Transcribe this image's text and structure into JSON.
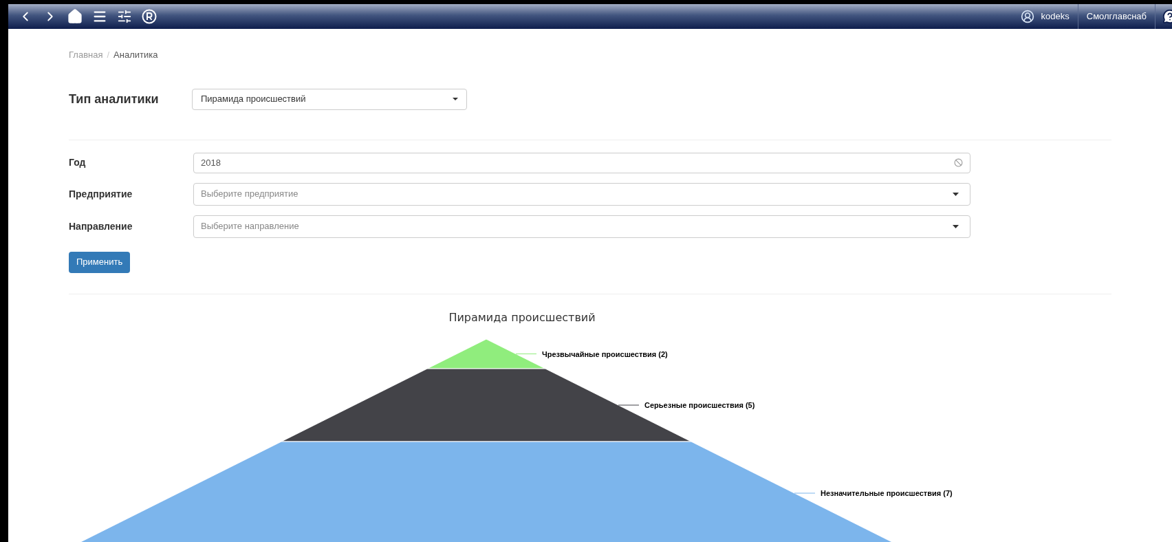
{
  "top_bar": {
    "user": "kodeks",
    "organization": "Смолглавснаб"
  },
  "breadcrumb_separator": "/",
  "breadcrumb": [
    {
      "label": "Главная",
      "kind": "link"
    },
    {
      "label": "Аналитика",
      "kind": "current"
    }
  ],
  "analytics_type": {
    "label": "Тип аналитики",
    "value": "Пирамида происшествий"
  },
  "filters": [
    {
      "label": "Год",
      "kind": "input",
      "value": "2018"
    },
    {
      "label": "Предприятие",
      "kind": "select",
      "placeholder": "Выберите предприятие"
    },
    {
      "label": "Направление",
      "kind": "select",
      "placeholder": "Выберите направление"
    }
  ],
  "apply_button": "Применить",
  "pyramid": {
    "title": "Пирамида происшествий",
    "levels": [
      {
        "label": "Чрезвычайные происшествия (2)",
        "color": "#90ed7d"
      },
      {
        "label": "Серьезные происшествия (5)",
        "color": "#434348"
      },
      {
        "label": "Незначительные происшествия (7)",
        "color": "#7cb5ec"
      }
    ]
  }
}
